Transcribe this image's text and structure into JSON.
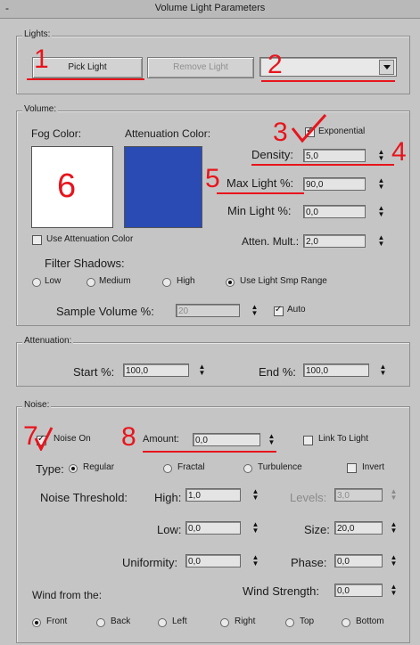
{
  "window": {
    "title": "Volume Light Parameters",
    "collapse_glyph": "-"
  },
  "lights": {
    "group_label": "Lights:",
    "pick_light": "Pick Light",
    "remove_light": "Remove Light",
    "dropdown_value": ""
  },
  "volume": {
    "group_label": "Volume:",
    "fog_color_label": "Fog Color:",
    "attenuation_color_label": "Attenuation Color:",
    "fog_color": "#ffffff",
    "attenuation_color": "#2a4bb3",
    "exponential_label": "Exponential",
    "exponential_checked": true,
    "density_label": "Density:",
    "density_value": "5,0",
    "max_light_label": "Max Light %:",
    "max_light_value": "90,0",
    "min_light_label": "Min Light %:",
    "min_light_value": "0,0",
    "use_attenuation_color_label": "Use Attenuation Color",
    "use_attenuation_color_checked": false,
    "atten_mult_label": "Atten. Mult.:",
    "atten_mult_value": "2,0",
    "filter_shadows_label": "Filter Shadows:",
    "filter_options": [
      "Low",
      "Medium",
      "High",
      "Use Light Smp Range"
    ],
    "filter_selected": 3,
    "sample_volume_label": "Sample Volume %:",
    "sample_volume_value": "20",
    "auto_label": "Auto",
    "auto_checked": true
  },
  "attenuation": {
    "group_label": "Attenuation:",
    "start_label": "Start %:",
    "start_value": "100,0",
    "end_label": "End %:",
    "end_value": "100,0"
  },
  "noise": {
    "group_label": "Noise:",
    "noise_on_label": "Noise On",
    "noise_on_checked": true,
    "amount_label": "Amount:",
    "amount_value": "0,0",
    "link_to_light_label": "Link To Light",
    "link_to_light_checked": false,
    "type_label": "Type:",
    "type_options": [
      "Regular",
      "Fractal",
      "Turbulence"
    ],
    "type_selected": 0,
    "invert_label": "Invert",
    "invert_checked": false,
    "noise_threshold_label": "Noise Threshold:",
    "high_label": "High:",
    "high_value": "1,0",
    "levels_label": "Levels:",
    "levels_value": "3,0",
    "low_label": "Low:",
    "low_value": "0,0",
    "size_label": "Size:",
    "size_value": "20,0",
    "uniformity_label": "Uniformity:",
    "uniformity_value": "0,0",
    "phase_label": "Phase:",
    "phase_value": "0,0",
    "wind_from_label": "Wind from the:",
    "wind_strength_label": "Wind Strength:",
    "wind_strength_value": "0,0",
    "wind_options": [
      "Front",
      "Back",
      "Left",
      "Right",
      "Top",
      "Bottom"
    ],
    "wind_selected": 0
  },
  "annotations": [
    "1",
    "2",
    "3",
    "4",
    "5",
    "6",
    "7",
    "8"
  ],
  "annotation_color": "#e8141c"
}
